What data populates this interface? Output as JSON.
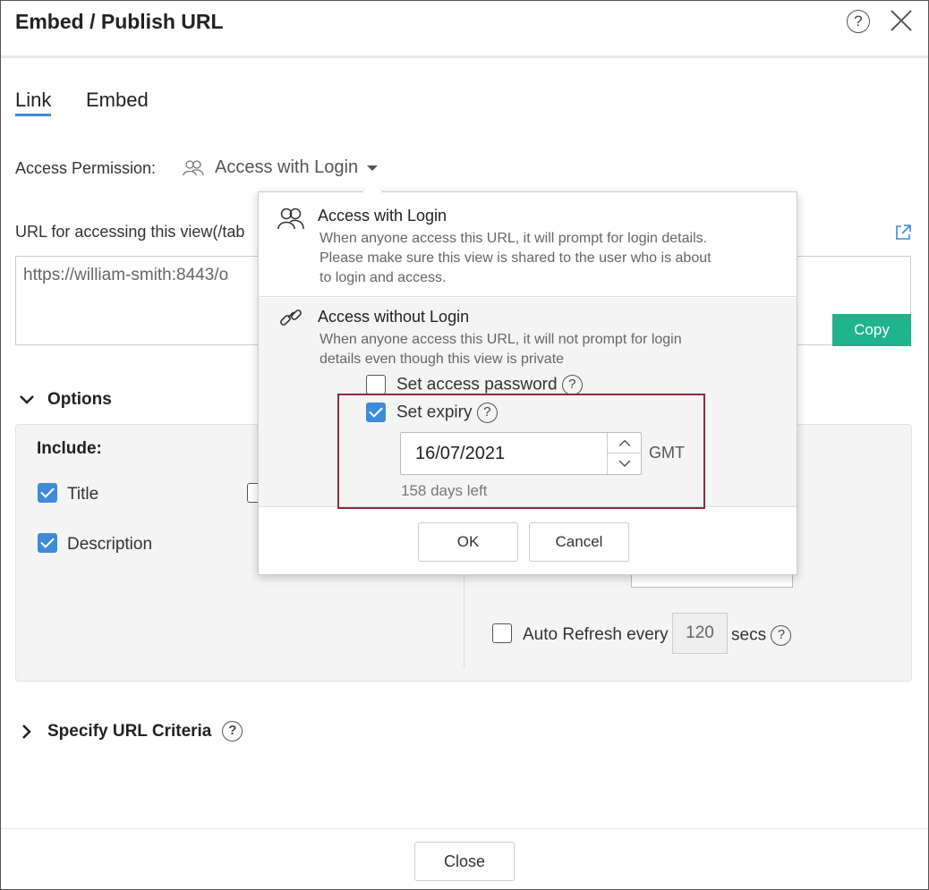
{
  "dialog": {
    "title": "Embed / Publish URL",
    "help_label": "?",
    "close_label": "Close"
  },
  "tabs": [
    {
      "label": "Link",
      "active": true
    },
    {
      "label": "Embed",
      "active": false
    }
  ],
  "access": {
    "label": "Access Permission:",
    "selected": "Access with Login"
  },
  "url": {
    "label": "URL for accessing this view(/tab",
    "value": "https://william-smith:8443/o",
    "copy_label": "Copy"
  },
  "options": {
    "heading": "Options",
    "include_label": "Include:",
    "title_label": "Title",
    "title_checked": true,
    "description_label": "Description",
    "description_checked": true,
    "auto_refresh_label": "Auto Refresh every",
    "auto_refresh_value": "120",
    "auto_refresh_unit": "secs"
  },
  "criteria": {
    "heading": "Specify URL Criteria"
  },
  "popup": {
    "option1_title": "Access with Login",
    "option1_desc": "When anyone access this URL, it will prompt for login details. Please make sure this view is shared to the user who is about to login and access.",
    "option2_title": "Access without Login",
    "option2_desc": "When anyone access this URL, it will not prompt for login details even though this view is private",
    "password_label": "Set access password",
    "password_checked": false,
    "expiry_label": "Set expiry",
    "expiry_checked": true,
    "expiry_date": "16/07/2021",
    "timezone": "GMT",
    "days_left": "158 days left",
    "ok_label": "OK",
    "cancel_label": "Cancel"
  },
  "colors": {
    "accent": "#3d8bd9",
    "copy_button": "#1fb48d",
    "highlight_border": "#8b2b3a"
  }
}
